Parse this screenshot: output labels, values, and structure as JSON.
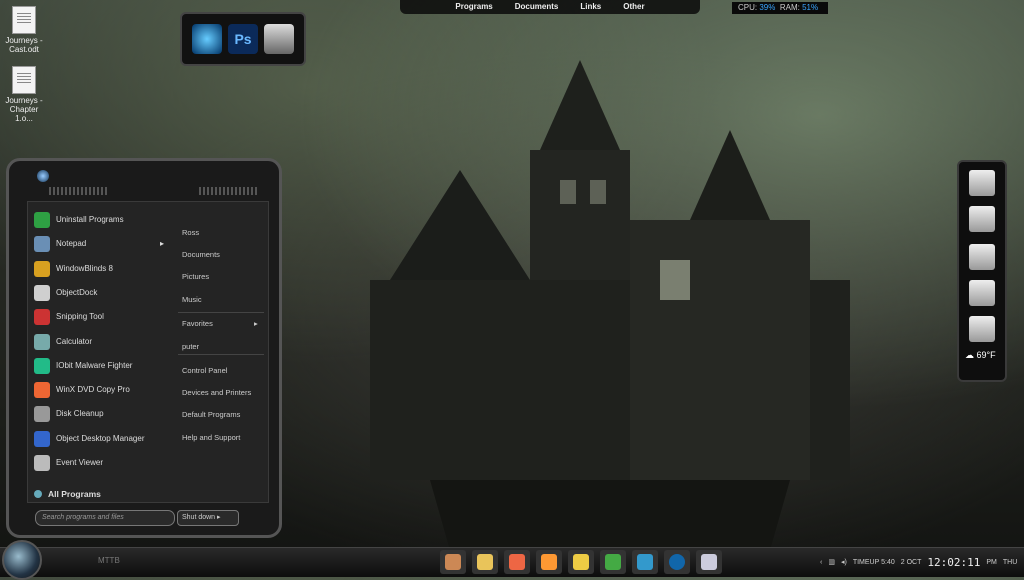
{
  "desktop": {
    "icons": [
      {
        "label": "Journeys - Cast.odt",
        "line1": "Journeys -",
        "line2": "Cast.odt"
      },
      {
        "label": "Journeys - Chapter 1.o",
        "line1": "Journeys -",
        "line2": "Chapter 1.o..."
      }
    ]
  },
  "launcher": {
    "ps_label": "Ps"
  },
  "top_menu": {
    "programs": "Programs",
    "documents": "Documents",
    "links": "Links",
    "other": "Other"
  },
  "sysmon": {
    "cpu_label": "CPU:",
    "cpu_value": "39%",
    "ram_label": "RAM:",
    "ram_value": "51%"
  },
  "start_menu": {
    "programs": [
      {
        "label": "Uninstall Programs",
        "icon": "uninstall-icon",
        "color": "#2ea043"
      },
      {
        "label": "Notepad",
        "icon": "notepad-icon",
        "color": "#6a8fb5"
      },
      {
        "label": "WindowBlinds 8",
        "icon": "windowblinds-icon",
        "color": "#d8a020"
      },
      {
        "label": "ObjectDock",
        "icon": "objectdock-icon",
        "color": "#cfcfcf"
      },
      {
        "label": "Snipping Tool",
        "icon": "snipping-tool-icon",
        "color": "#c33"
      },
      {
        "label": "Calculator",
        "icon": "calculator-icon",
        "color": "#7aa"
      },
      {
        "label": "IObit Malware Fighter",
        "icon": "iobit-icon",
        "color": "#2b8"
      },
      {
        "label": "WinX DVD Copy Pro",
        "icon": "winx-dvd-icon",
        "color": "#e63"
      },
      {
        "label": "Disk Cleanup",
        "icon": "disk-cleanup-icon",
        "color": "#999"
      },
      {
        "label": "Object Desktop Manager",
        "icon": "object-desktop-icon",
        "color": "#36c"
      },
      {
        "label": "Event Viewer",
        "icon": "event-viewer-icon",
        "color": "#bbb"
      }
    ],
    "all_programs": "All Programs",
    "places": [
      "Ross",
      "Documents",
      "Pictures",
      "Music",
      "Favorites",
      "puter",
      "Control Panel",
      "Devices and Printers",
      "Default Programs",
      "Help and Support"
    ],
    "search_placeholder": "Search programs and files",
    "shutdown": "Shut down"
  },
  "dock": {
    "weather_temp": "69°F"
  },
  "taskbar": {
    "title": "MTTB",
    "clock": "12:02:11",
    "clock_suffix": "PM",
    "day": "THU",
    "date_day": "2",
    "date_month": "OCT",
    "timer_label": "TIMEUP",
    "timer_value": "5:40"
  }
}
